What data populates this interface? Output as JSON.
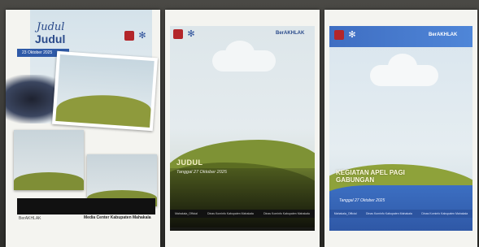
{
  "card1": {
    "script_title": "Judul",
    "title": "Judul",
    "date_badge": "23 Oktober 2025",
    "footer_left": "BerAKHLAK",
    "footer_right": "Media Center Kabupaten Mahakala",
    "brand": "BerAKHLAK"
  },
  "card2": {
    "brand": "BerAKHLAK",
    "title": "JUDUL",
    "date": "Tanggal 27 Oktober 2025",
    "footer_items": [
      "Mahakala_Official",
      "Dinas Kominfo Kabupaten Mahakala",
      "Dinas Kominfo Kabupaten Mahakala"
    ]
  },
  "card3": {
    "brand": "BerAKHLAK",
    "title": "KEGIATAN APEL PAGI GABUNGAN",
    "date": "Tanggal 27 Oktober 2025",
    "footer_items": [
      "Mahakala_Official",
      "Dinas Kominfo Kabupaten Mahakala",
      "Dinas Kominfo Kabupaten Mahakala"
    ]
  },
  "colors": {
    "navy": "#2a4a8a",
    "blue_bar": "#2f5aa8",
    "hill_green": "#7e9235",
    "red_logo": "#b3262a"
  }
}
